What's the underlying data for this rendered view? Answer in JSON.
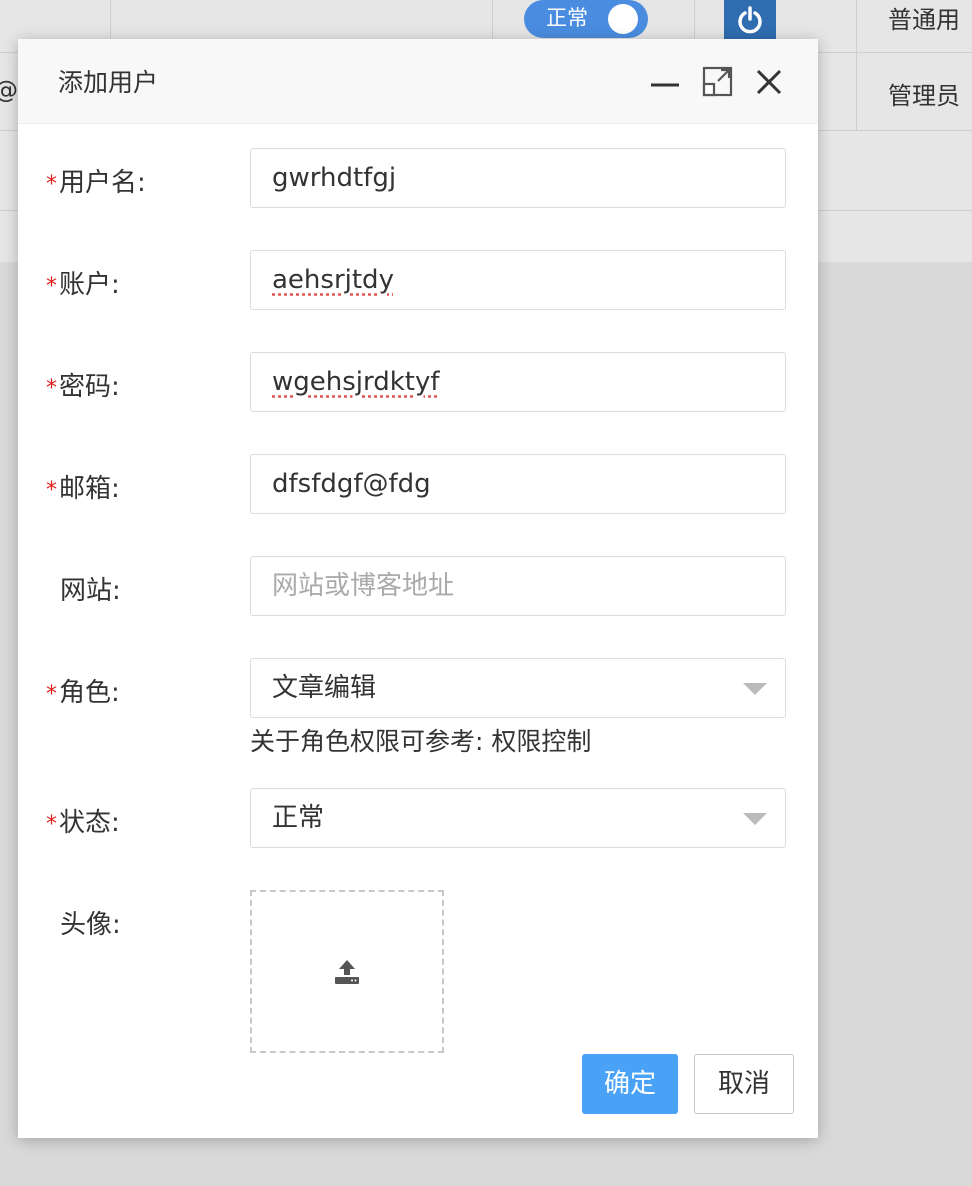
{
  "background": {
    "row1": {
      "status_toggle": "正常",
      "role": "普通用"
    },
    "row2": {
      "email_fragment": "@i",
      "role": "管理员"
    }
  },
  "dialog": {
    "title": "添加用户",
    "fields": {
      "username": {
        "label": "用户名:",
        "value": "gwrhdtfgj",
        "required": true
      },
      "account": {
        "label": "账户:",
        "value": "aehsrjtdy",
        "required": true
      },
      "password": {
        "label": "密码:",
        "value": "wgehsjrdktyf",
        "required": true
      },
      "email": {
        "label": "邮箱:",
        "value": "dfsfdgf@fdg",
        "required": true
      },
      "website": {
        "label": "网站:",
        "placeholder": "网站或博客地址",
        "required": false
      },
      "role": {
        "label": "角色:",
        "value": "文章编辑",
        "hint": "关于角色权限可参考: 权限控制",
        "required": true
      },
      "status": {
        "label": "状态:",
        "value": "正常",
        "required": true
      },
      "avatar": {
        "label": "头像:",
        "required": false
      }
    },
    "required_mark": "*",
    "buttons": {
      "ok": "确定",
      "cancel": "取消"
    }
  },
  "colors": {
    "primary": "#4aa2f7",
    "required": "#e02020",
    "toggle": "#4a8de0"
  },
  "icons": [
    "minimize-icon",
    "maximize-icon",
    "close-icon",
    "upload-icon",
    "power-icon",
    "chevron-down-icon"
  ]
}
